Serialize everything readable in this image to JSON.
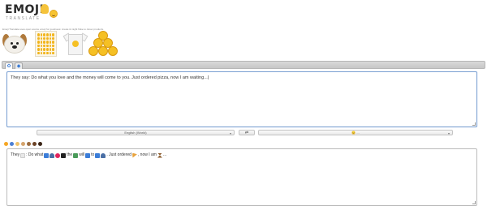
{
  "header": {
    "logo_word": "EMOJI",
    "logo_sub": "TRANSLATE",
    "tagline": "Emoji Translate uses open source emoji for goodness: create & might fluke to clever products."
  },
  "tabs": [
    {
      "icon": "emoji-text-tab-icon",
      "label": "✿"
    },
    {
      "icon": "text-emoji-tab-icon",
      "label": "◆"
    }
  ],
  "input": {
    "text": "They say: Do what you love and the money will come to you. Just ordered pizza, now I am waiting...|"
  },
  "controls": {
    "language": "English (World)",
    "swap_label": "⇄",
    "emoji_set": "😊 ..."
  },
  "variants": [
    "#f5a623",
    "#4a7fd4",
    "#f0c36b",
    "#d4a36c",
    "#9b6b3e",
    "#6b4226",
    "#3b2416"
  ],
  "output": {
    "t1": "They",
    "t2": ": Do what",
    "t3": "the",
    "t4": "will",
    "t5": "to",
    "t6": ". Just ordered",
    "t7": ", now I am",
    "t8": "..."
  }
}
